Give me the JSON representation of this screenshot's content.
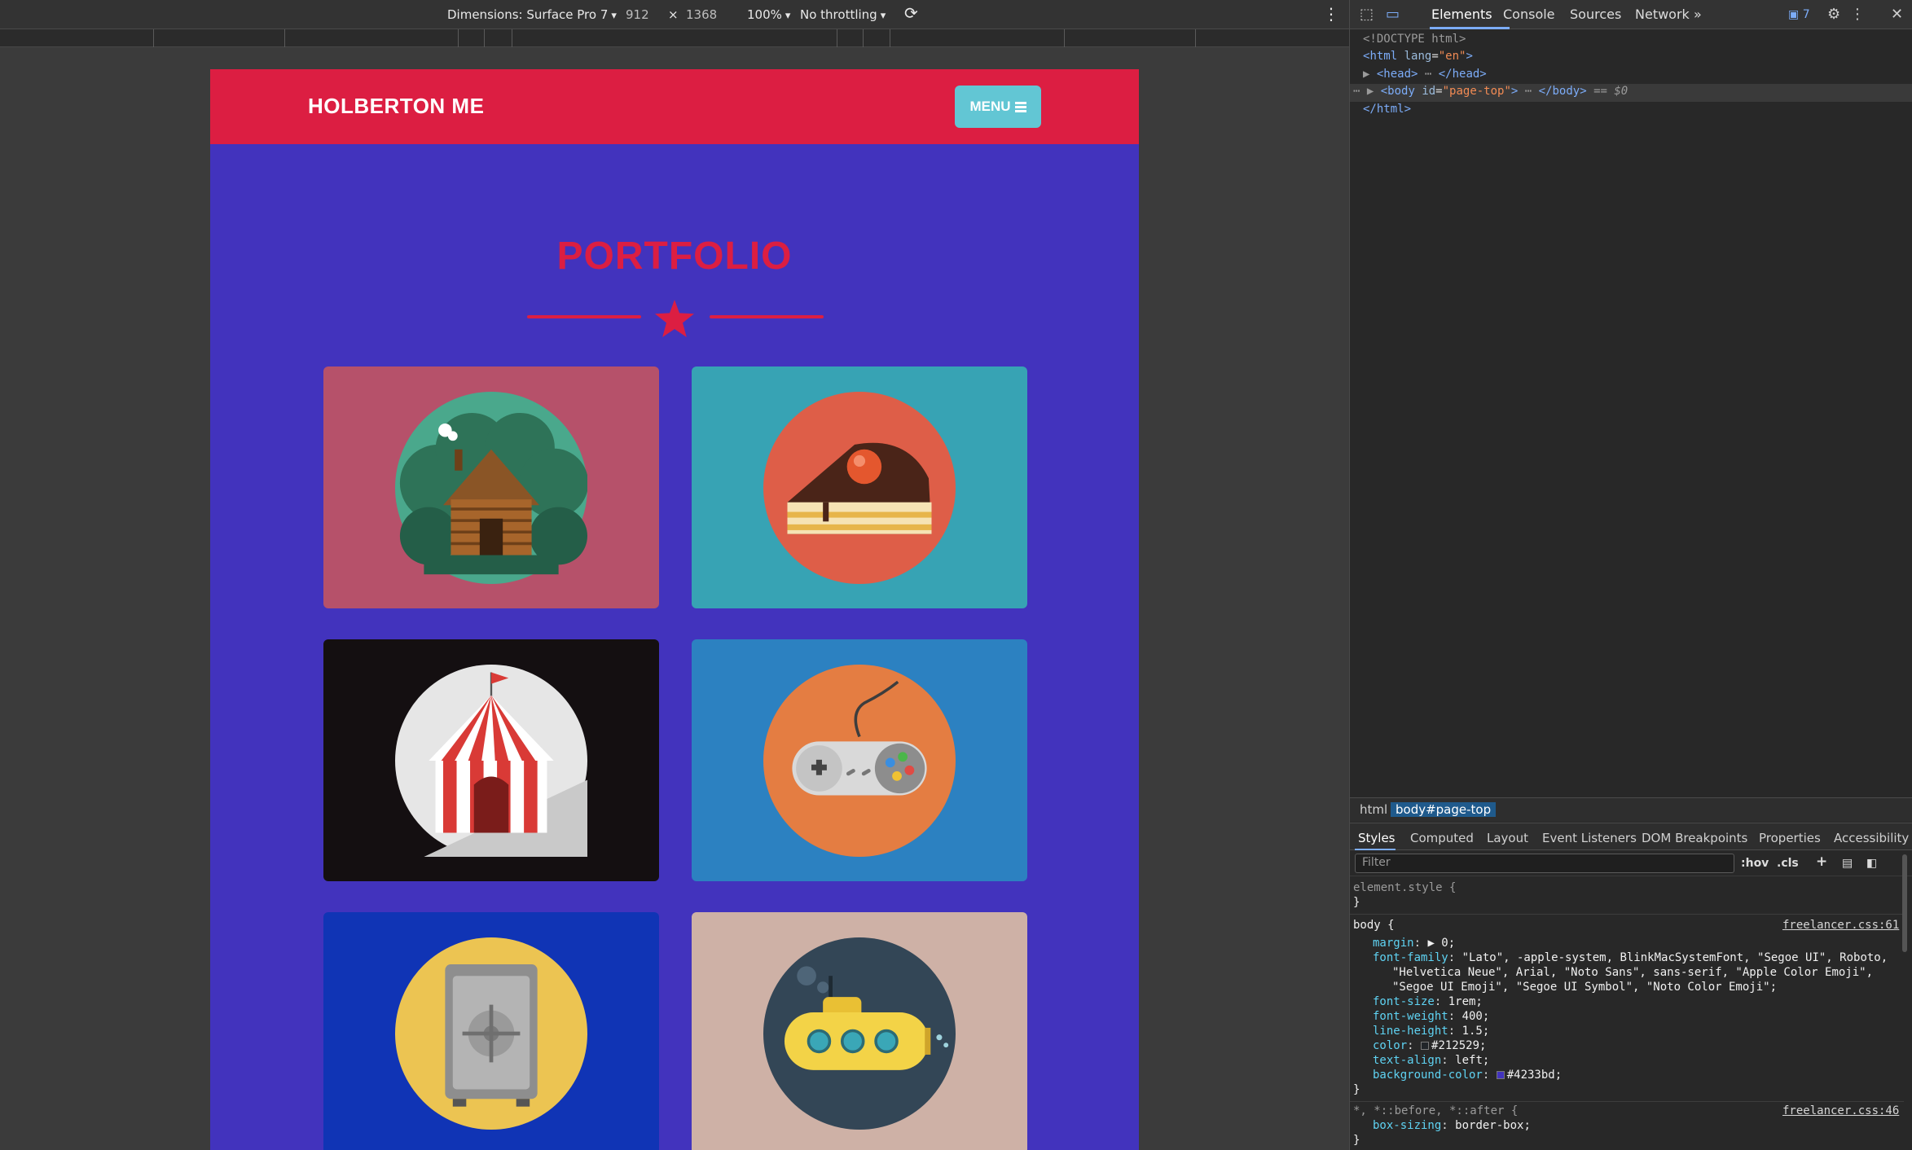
{
  "toolbar": {
    "dimensions_label": "Dimensions: Surface Pro 7",
    "width": "912",
    "times": "×",
    "height": "1368",
    "zoom": "100%",
    "throttling": "No throttling"
  },
  "site": {
    "brand": "HOLBERTON ME",
    "menu_label": "MENU",
    "heading": "PORTFOLIO",
    "colors": {
      "nav": "#dc1e42",
      "background": "#4233bd",
      "accent": "#dc1e42",
      "menu": "#62c6d4"
    },
    "portfolio": [
      {
        "name": "log-cabin",
        "icon": "cabin-icon",
        "card_color": "#b6516a",
        "circle_color": "#4aa88c"
      },
      {
        "name": "cake",
        "icon": "cake-icon",
        "card_color": "#37a3b4",
        "circle_color": "#de5e48"
      },
      {
        "name": "circus-tent",
        "icon": "circus-tent-icon",
        "card_color": "#140f11",
        "circle_color": "#e6e6e6"
      },
      {
        "name": "game-controller",
        "icon": "controller-icon",
        "card_color": "#2c81c1",
        "circle_color": "#e47d42"
      },
      {
        "name": "safe",
        "icon": "safe-icon",
        "card_color": "#1034b5",
        "circle_color": "#ecc452"
      },
      {
        "name": "submarine",
        "icon": "submarine-icon",
        "card_color": "#ceb1a6",
        "circle_color": "#334656"
      }
    ]
  },
  "devtools": {
    "tabs": [
      "Elements",
      "Console",
      "Sources",
      "Network"
    ],
    "more": "»",
    "issues_count": "7",
    "dom": {
      "doctype": "<!DOCTYPE html>",
      "html_open_tag": "html",
      "html_lang_attr": "lang",
      "html_lang_val": "\"en\"",
      "head": "<head>",
      "head_close": "</head>",
      "body_tag": "body",
      "body_attr": "id",
      "body_val": "\"page-top\"",
      "body_close": "</body>",
      "selected_marker": "== $0",
      "html_close": "</html>"
    },
    "breadcrumbs": [
      "html",
      "body#page-top"
    ],
    "style_tabs": [
      "Styles",
      "Computed",
      "Layout",
      "Event Listeners",
      "DOM Breakpoints",
      "Properties",
      "Accessibility"
    ],
    "filter_placeholder": "Filter",
    "hov": ":hov",
    "cls": ".cls",
    "rules": {
      "element_style": "element.style {",
      "close": "}",
      "body_selector": "body {",
      "body_source": "freelancer.css:61",
      "decls": [
        {
          "prop": "margin",
          "value": "▶ 0;"
        },
        {
          "prop": "font-family",
          "value": "\"Lato\", -apple-system, BlinkMacSystemFont, \"Segoe UI\", Roboto,"
        },
        {
          "prop": "",
          "value": "\"Helvetica Neue\", Arial, \"Noto Sans\", sans-serif, \"Apple Color Emoji\","
        },
        {
          "prop": "",
          "value": "\"Segoe UI Emoji\", \"Segoe UI Symbol\", \"Noto Color Emoji\";"
        },
        {
          "prop": "font-size",
          "value": "1rem;"
        },
        {
          "prop": "font-weight",
          "value": "400;"
        },
        {
          "prop": "line-height",
          "value": "1.5;"
        },
        {
          "prop": "color",
          "value": "#212529;"
        },
        {
          "prop": "text-align",
          "value": "left;"
        },
        {
          "prop": "background-color",
          "value": "#4233bd;"
        }
      ],
      "universal_selector": "*, *::before, *::after {",
      "universal_source": "freelancer.css:46",
      "box_sizing_prop": "box-sizing",
      "box_sizing_val": "border-box;"
    }
  }
}
